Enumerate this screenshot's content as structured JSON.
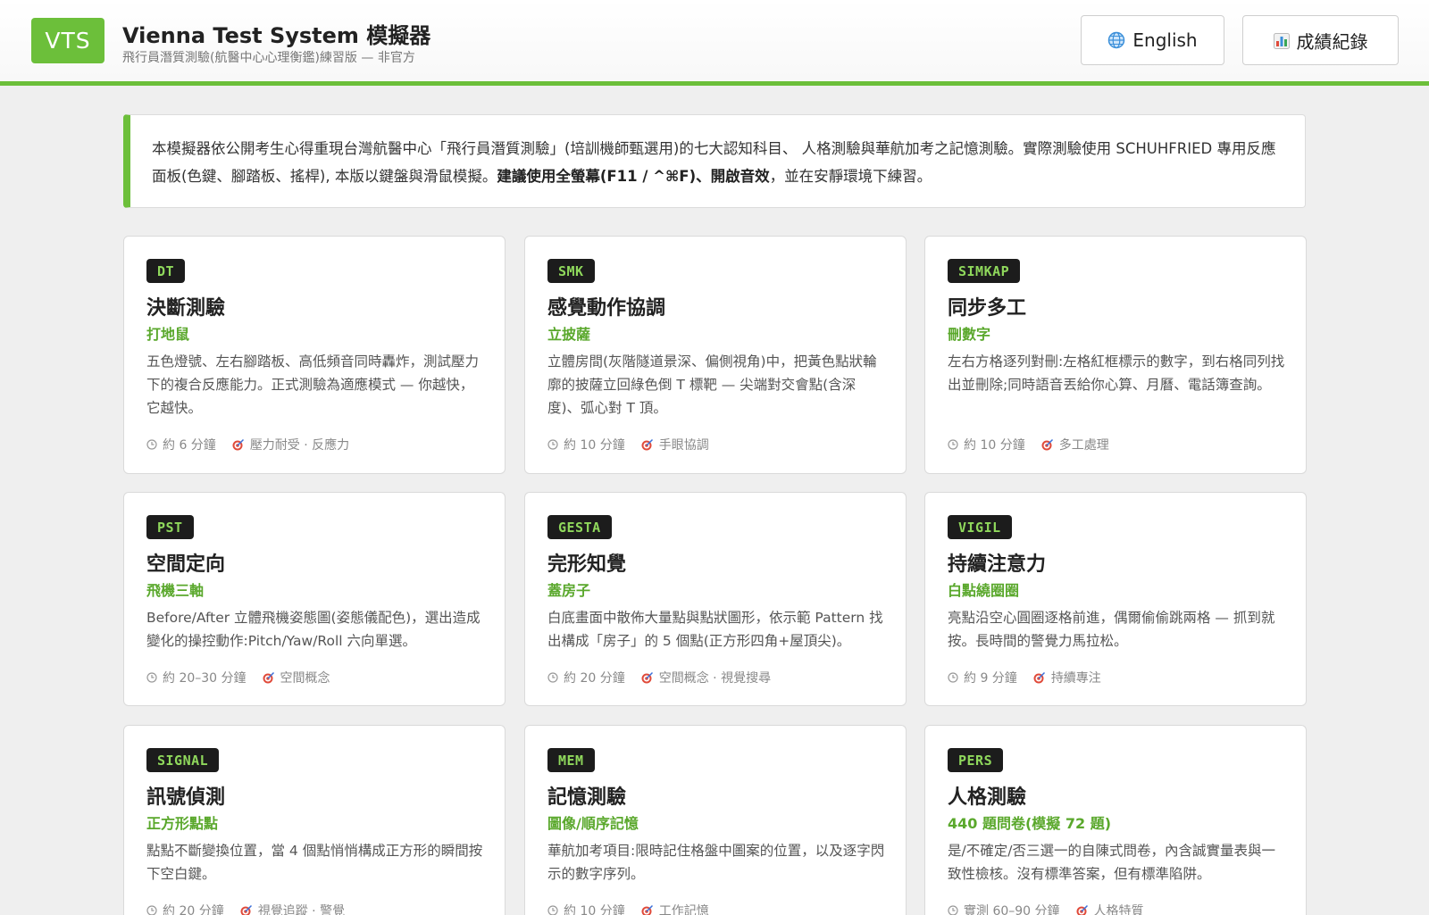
{
  "header": {
    "logo_text": "VTS",
    "title": "Vienna Test System 模擬器",
    "subtitle": "飛行員潛質測驗(航醫中心心理衡鑑)練習版 — 非官方",
    "lang_button": "English",
    "records_button": "成績紀錄"
  },
  "notice": {
    "text_part1": "本模擬器依公開考生心得重現台灣航醫中心「飛行員潛質測驗」(培訓機師甄選用)的七大認知科目、 人格測驗與華航加考之記憶測驗。實際測驗使用 SCHUHFRIED 專用反應面板(色鍵、腳踏板、搖桿), 本版以鍵盤與滑鼠模擬。",
    "text_bold": "建議使用全螢幕(F11 / ^⌘F)、開啟音效",
    "text_part2": "，並在安靜環境下練習。"
  },
  "cards": [
    {
      "code": "DT",
      "title": "決斷測驗",
      "subtitle": "打地鼠",
      "desc": "五色燈號、左右腳踏板、高低頻音同時轟炸，測試壓力下的複合反應能力。正式測驗為適應模式 — 你越快，它越快。",
      "duration": "約 6 分鐘",
      "skill": "壓力耐受 · 反應力"
    },
    {
      "code": "SMK",
      "title": "感覺動作協調",
      "subtitle": "立披薩",
      "desc": "立體房間(灰階隧道景深、偏側視角)中，把黃色點狀輪廓的披薩立回綠色倒 T 標靶 — 尖端對交會點(含深度)、弧心對 T 頂。",
      "duration": "約 10 分鐘",
      "skill": "手眼協調"
    },
    {
      "code": "SIMKAP",
      "title": "同步多工",
      "subtitle": "刪數字",
      "desc": "左右方格逐列對刪:左格紅框標示的數字，到右格同列找出並刪除;同時語音丟給你心算、月曆、電話簿查詢。",
      "duration": "約 10 分鐘",
      "skill": "多工處理"
    },
    {
      "code": "PST",
      "title": "空間定向",
      "subtitle": "飛機三軸",
      "desc": "Before/After 立體飛機姿態圖(姿態儀配色)，選出造成變化的操控動作:Pitch/Yaw/Roll 六向單選。",
      "duration": "約 20–30 分鐘",
      "skill": "空間概念"
    },
    {
      "code": "GESTA",
      "title": "完形知覺",
      "subtitle": "蓋房子",
      "desc": "白底畫面中散佈大量點與點狀圖形，依示範 Pattern 找出構成「房子」的 5 個點(正方形四角+屋頂尖)。",
      "duration": "約 20 分鐘",
      "skill": "空間概念 · 視覺搜尋"
    },
    {
      "code": "VIGIL",
      "title": "持續注意力",
      "subtitle": "白點繞圈圈",
      "desc": "亮點沿空心圓圈逐格前進，偶爾偷偷跳兩格 — 抓到就按。長時間的警覺力馬拉松。",
      "duration": "約 9 分鐘",
      "skill": "持續專注"
    },
    {
      "code": "SIGNAL",
      "title": "訊號偵測",
      "subtitle": "正方形點點",
      "desc": "點點不斷變換位置，當 4 個點悄悄構成正方形的瞬間按下空白鍵。",
      "duration": "約 20 分鐘",
      "skill": "視覺追蹤 · 警覺"
    },
    {
      "code": "MEM",
      "title": "記憶測驗",
      "subtitle": "圖像/順序記憶",
      "desc": "華航加考項目:限時記住格盤中圖案的位置，以及逐字閃示的數字序列。",
      "duration": "約 10 分鐘",
      "skill": "工作記憶"
    },
    {
      "code": "PERS",
      "title": "人格測驗",
      "subtitle": "440 題問卷(模擬 72 題)",
      "desc": "是/不確定/否三選一的自陳式問卷，內含誠實量表與一致性檢核。沒有標準答案，但有標準陷阱。",
      "duration": "實測 60–90 分鐘",
      "skill": "人格特質"
    }
  ]
}
